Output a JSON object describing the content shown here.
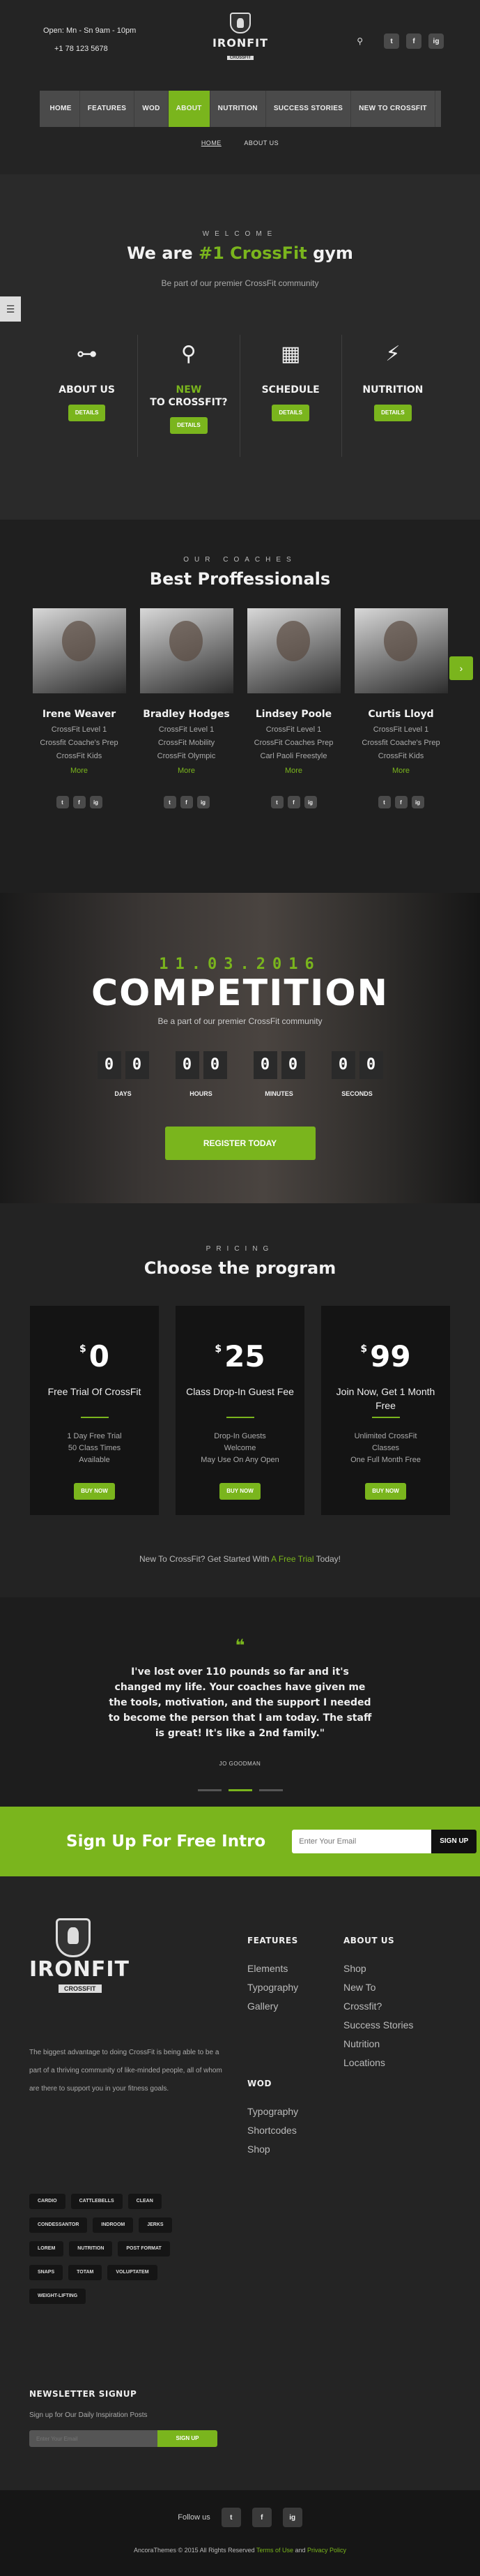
{
  "header": {
    "hours": "Open: Mn - Sn 9am - 10pm",
    "phone": "+1 78 123 5678",
    "logo_name": "IRONFIT",
    "logo_sub": "CROSSFIT",
    "social": [
      "t",
      "f",
      "ig"
    ]
  },
  "nav": {
    "items": [
      "HOME",
      "FEATURES",
      "WOD",
      "ABOUT",
      "NUTRITION",
      "SUCCESS STORIES",
      "NEW TO CROSSFIT"
    ],
    "active": "ABOUT"
  },
  "breadcrumb": {
    "home": "HOME",
    "current": "ABOUT US"
  },
  "welcome": {
    "kicker": "WELCOME",
    "title_pre": "We are ",
    "title_accent": "#1 CrossFit",
    "title_post": " gym",
    "lead": "Be part of our premier CrossFit community",
    "side_tab_icon": "menu-icon",
    "features": [
      {
        "icon": "dumbbell-icon",
        "glyph": "⊶",
        "title": "ABOUT US",
        "title_accent": "",
        "button": "DETAILS"
      },
      {
        "icon": "person-icon",
        "glyph": "⚲",
        "title_accent": "NEW",
        "title": "TO CROSSFIT?",
        "button": "DETAILS"
      },
      {
        "icon": "calendar-icon",
        "glyph": "▦",
        "title": "SCHEDULE",
        "title_accent": "",
        "button": "DETAILS"
      },
      {
        "icon": "nutrition-icon",
        "glyph": "⚡",
        "title": "NUTRITION",
        "title_accent": "",
        "button": "DETAILS"
      }
    ]
  },
  "coaches": {
    "kicker": "OUR COACHES",
    "title": "Best Proffessionals",
    "items": [
      {
        "name": "Irene Weaver",
        "lines": [
          "CrossFit Level 1",
          "Crossfit Coache's Prep",
          "CrossFit Kids"
        ],
        "more": "More"
      },
      {
        "name": "Bradley Hodges",
        "lines": [
          "CrossFit Level 1",
          "CrossFit Mobility",
          "CrossFit Olympic"
        ],
        "more": "More"
      },
      {
        "name": "Lindsey Poole",
        "lines": [
          "CrossFit Level 1",
          "CrossFit Coaches Prep",
          "Carl Paoli Freestyle"
        ],
        "more": "More"
      },
      {
        "name": "Curtis Lloyd",
        "lines": [
          "CrossFit Level 1",
          "Crossfit Coache's Prep",
          "CrossFit Kids"
        ],
        "more": "More"
      }
    ],
    "social": [
      "t",
      "f",
      "ig"
    ]
  },
  "competition": {
    "date": "11.03.2016",
    "title": "COMPETITION",
    "subtitle": "Be a part of our premier CrossFit community",
    "units": [
      {
        "label": "DAYS",
        "digits": [
          "0",
          "0"
        ]
      },
      {
        "label": "HOURS",
        "digits": [
          "0",
          "0"
        ]
      },
      {
        "label": "MINUTES",
        "digits": [
          "0",
          "0"
        ]
      },
      {
        "label": "SECONDS",
        "digits": [
          "0",
          "0"
        ]
      }
    ],
    "button": "REGISTER TODAY"
  },
  "pricing": {
    "kicker": "PRICING",
    "title": "Choose the program",
    "currency": "$",
    "plans": [
      {
        "price": "0",
        "name": "Free Trial Of CrossFit",
        "features": [
          "1 Day Free Trial",
          "50 Class Times",
          "Available"
        ],
        "button": "BUY NOW"
      },
      {
        "price": "25",
        "name": "Class Drop-In Guest Fee",
        "features": [
          "Drop-In Guests",
          "Welcome",
          "May Use On Any Open"
        ],
        "button": "BUY NOW"
      },
      {
        "price": "99",
        "name": "Join Now, Get 1 Month Free",
        "features": [
          "Unlimited CrossFit",
          "Classes",
          "One Full Month Free"
        ],
        "button": "BUY NOW"
      }
    ],
    "trial_pre": "New To CrossFit? Get Started With ",
    "trial_link": "A Free Trial",
    "trial_post": " Today!"
  },
  "testimonial": {
    "quote_mark": "❝",
    "text": "I've lost over 110 pounds so far and it's changed my life. Your coaches have given me the tools, motivation, and the support I needed to become the person that I am today. The staff is great! It's like a 2nd family.\"",
    "author": "JO GOODMAN"
  },
  "signup": {
    "title": "Sign Up For Free Intro",
    "placeholder": "Enter Your Email",
    "button": "SIGN UP"
  },
  "footer": {
    "logo_name": "IRONFIT",
    "logo_sub": "CROSSFIT",
    "description": "The biggest advantage to doing CrossFit is being able to be a part of a thriving community of like-minded people, all of whom are there to support you in your fitness goals.",
    "features_title": "FEATURES",
    "features_links": [
      "Elements",
      "Typography",
      "Gallery"
    ],
    "wod_title": "WOD",
    "wod_links": [
      "Typography",
      "Shortcodes",
      "Shop"
    ],
    "about_title": "ABOUT US",
    "about_links": [
      "Shop",
      "New To",
      "Crossfit?",
      "Success Stories",
      "Nutrition",
      "Locations"
    ],
    "tags": [
      "CARDIO",
      "CATTLEBELLS",
      "CLEAN",
      "CONDESSANTOR",
      "INDROOM",
      "JERKS",
      "LOREM",
      "NUTRITION",
      "POST FORMAT",
      "SNAPS",
      "TOTAM",
      "VOLUPTATEM",
      "WEIGHT-LIFTING"
    ],
    "newsletter_title": "NEWSLETTER SIGNUP",
    "newsletter_text": "Sign up for Our Daily Inspiration Posts",
    "newsletter_placeholder": "Enter Your Email",
    "newsletter_button": "SIGN UP"
  },
  "bottom": {
    "follow": "Follow us",
    "social": [
      "t",
      "f",
      "ig"
    ],
    "copy_pre": "AncoraThemes © 2015 All Rights Reserved ",
    "terms": "Terms of Use",
    "and": " and ",
    "privacy": "Privacy Policy"
  }
}
